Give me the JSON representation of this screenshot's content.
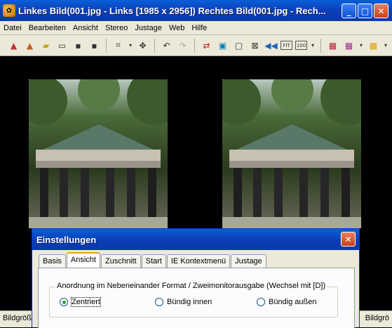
{
  "window": {
    "title": "Linkes Bild(001.jpg - Links [1985 x 2956]) Rechtes Bild(001.jpg - Rech..."
  },
  "menu": [
    "Datei",
    "Bearbeiten",
    "Ansicht",
    "Stereo",
    "Justage",
    "Web",
    "Hilfe"
  ],
  "toolbar": {
    "fit_label": "FIT",
    "zoom_label": "100"
  },
  "status": {
    "left": "Bildgröße",
    "right": "Bildgrö"
  },
  "dialog": {
    "title": "Einstellungen",
    "tabs": [
      "Basis",
      "Ansicht",
      "Zuschnitt",
      "Start",
      "IE Kontextmenü",
      "Justage"
    ],
    "active_tab": "Ansicht",
    "group_label": "Anordnung im Nebeneinander Format / Zweimonitorausgabe (Wechsel mit [D])",
    "options": [
      "Zentriert",
      "Bündig innen",
      "Bündig außen"
    ],
    "selected_option": "Zentriert"
  },
  "colors": {
    "titlebar": "#0b3fb8",
    "chrome": "#ece9d8",
    "viewer_bg": "#000000"
  }
}
